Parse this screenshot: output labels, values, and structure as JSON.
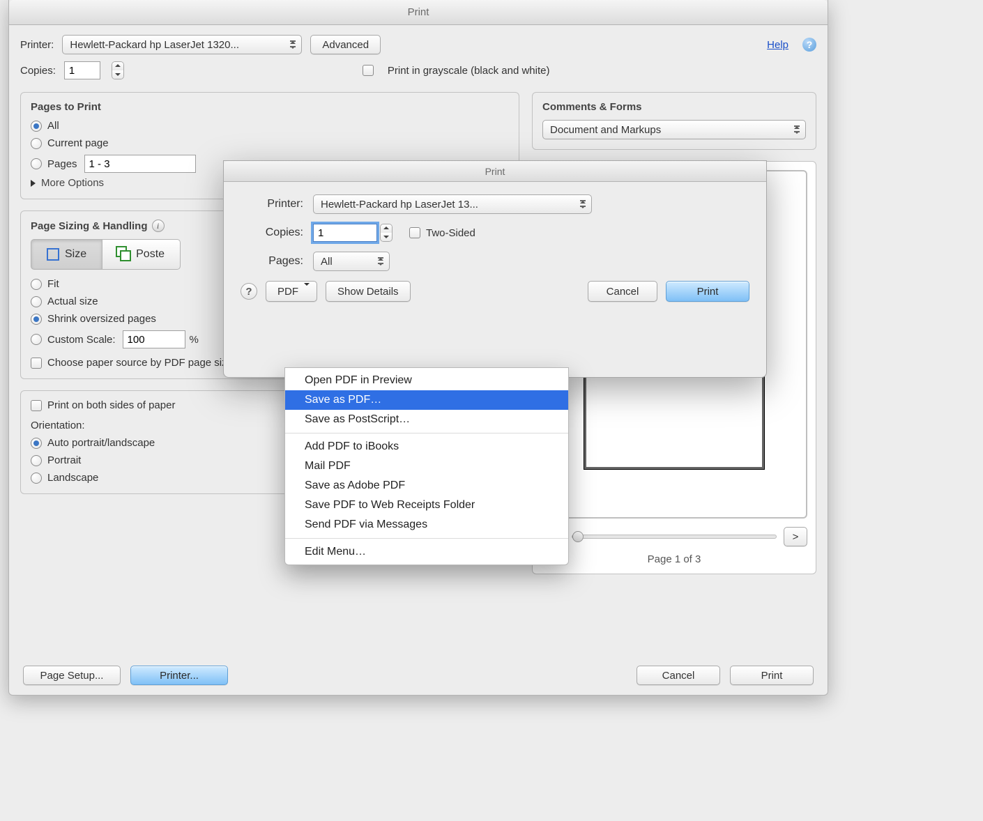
{
  "outer_window": {
    "title": "Print",
    "help_link": "Help",
    "top": {
      "printer_label": "Printer:",
      "printer_value": "Hewlett-Packard hp LaserJet 1320...",
      "advanced_btn": "Advanced",
      "copies_label": "Copies:",
      "copies_value": "1",
      "grayscale_label": "Print in grayscale (black and white)"
    },
    "pages_to_print": {
      "title": "Pages to Print",
      "all": "All",
      "current": "Current page",
      "pages": "Pages",
      "range": "1 - 3",
      "more": "More Options"
    },
    "comments_forms": {
      "title": "Comments & Forms",
      "value": "Document and Markups"
    },
    "sizing": {
      "title": "Page Sizing & Handling",
      "size_btn": "Size",
      "poster_btn": "Poster",
      "fit": "Fit",
      "actual": "Actual size",
      "shrink": "Shrink oversized pages",
      "custom": "Custom Scale:",
      "custom_value": "100",
      "pct": "%",
      "paper_source": "Choose paper source by PDF page size"
    },
    "both_sides": "Print on both sides of paper",
    "orientation": {
      "title": "Orientation:",
      "auto": "Auto portrait/landscape",
      "portrait": "Portrait",
      "landscape": "Landscape"
    },
    "preview": {
      "prev": "<",
      "next": ">",
      "caption": "Page 1 of 3"
    },
    "bottom": {
      "page_setup": "Page Setup...",
      "printer_btn": "Printer...",
      "cancel": "Cancel",
      "print": "Print"
    }
  },
  "sheet": {
    "title": "Print",
    "printer_label": "Printer:",
    "printer_value": "Hewlett-Packard hp LaserJet 13...",
    "copies_label": "Copies:",
    "copies_value": "1",
    "two_sided": "Two-Sided",
    "pages_label": "Pages:",
    "pages_value": "All",
    "pdf_btn": "PDF",
    "show_details": "Show Details",
    "cancel": "Cancel",
    "print": "Print"
  },
  "menu": {
    "items": [
      "Open PDF in Preview",
      "Save as PDF…",
      "Save as PostScript…",
      "__sep__",
      "Add PDF to iBooks",
      "Mail PDF",
      "Save as Adobe PDF",
      "Save PDF to Web Receipts Folder",
      "Send PDF via Messages",
      "__sep__",
      "Edit Menu…"
    ],
    "highlighted_index": 1
  }
}
